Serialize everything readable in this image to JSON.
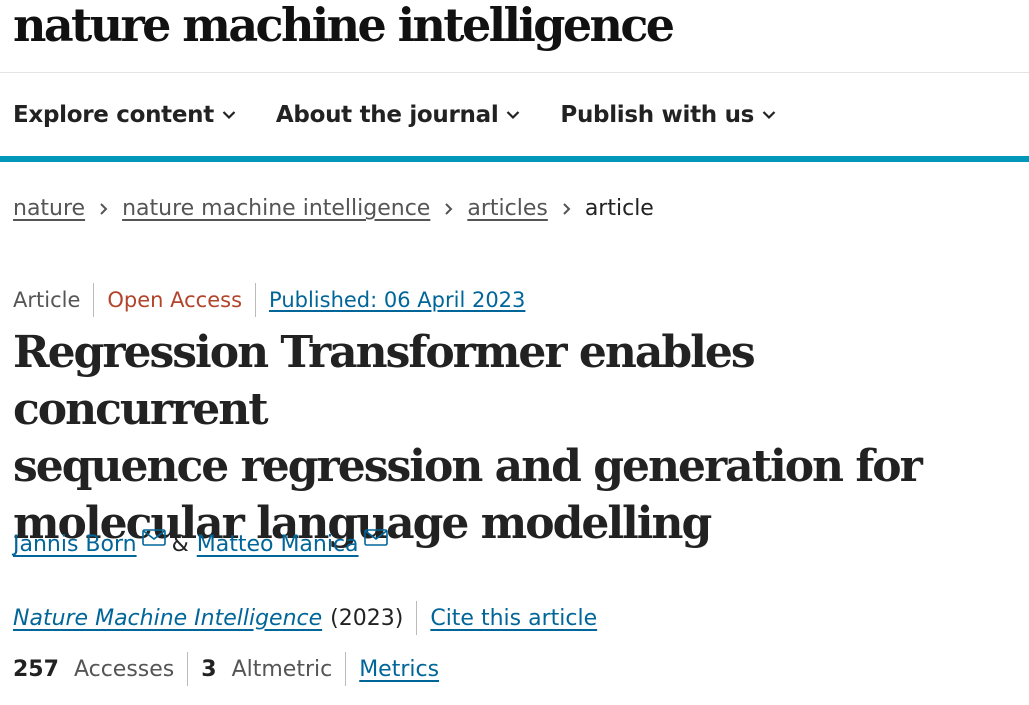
{
  "brand": {
    "title": "nature machine intelligence"
  },
  "nav": {
    "items": [
      {
        "label": "Explore content"
      },
      {
        "label": "About the journal"
      },
      {
        "label": "Publish with us"
      }
    ]
  },
  "breadcrumb": {
    "items": [
      "nature",
      "nature machine intelligence",
      "articles"
    ],
    "current": "article"
  },
  "article_meta": {
    "type": "Article",
    "access": "Open Access",
    "published": "Published: 06 April 2023"
  },
  "title": {
    "line1": "Regression Transformer enables concurrent",
    "line2": "sequence regression and generation for",
    "line3": "molecular language modelling"
  },
  "authors": {
    "first": "Jannis Born",
    "separator": "&",
    "second": "Matteo Manica"
  },
  "citation": {
    "journal": "Nature Machine Intelligence",
    "year": "(2023)",
    "cite_link": "Cite this article"
  },
  "metrics": {
    "accesses_count": "257",
    "accesses_label": "Accesses",
    "altmetric_count": "3",
    "altmetric_label": "Altmetric",
    "metrics_link": "Metrics"
  },
  "colors": {
    "accent": "#0097b8",
    "link": "#006699",
    "open_access": "#b1442a"
  }
}
